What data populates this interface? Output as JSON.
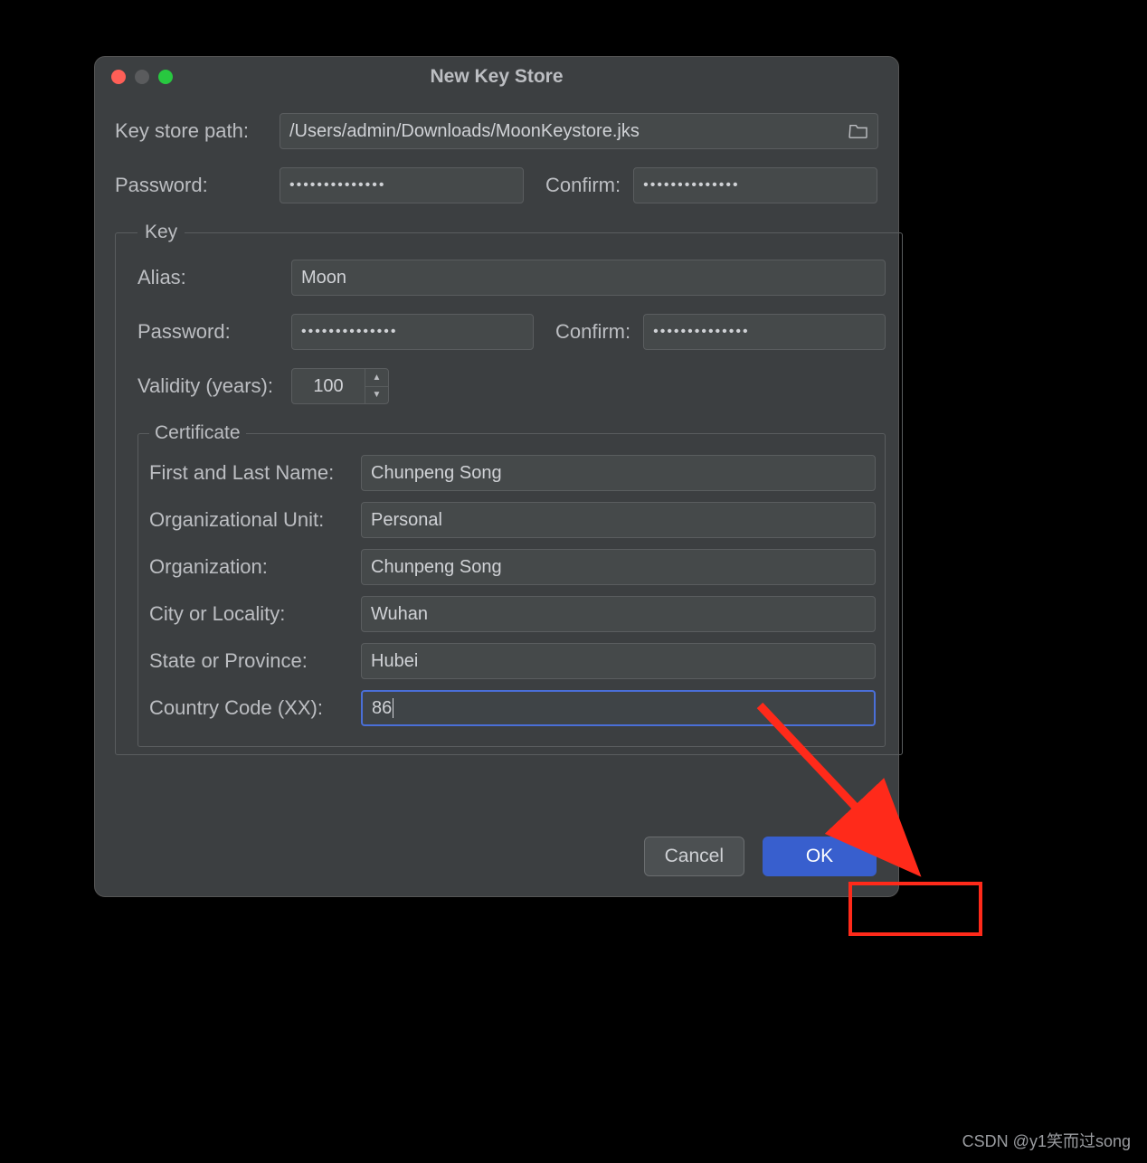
{
  "dialog": {
    "title": "New Key Store",
    "keystore_path_label": "Key store path:",
    "keystore_path_value": "/Users/admin/Downloads/MoonKeystore.jks",
    "password_label": "Password:",
    "password_value": "••••••••••••••",
    "confirm_label": "Confirm:",
    "confirm_value": "••••••••••••••"
  },
  "key": {
    "legend": "Key",
    "alias_label": "Alias:",
    "alias_value": "Moon",
    "password_label": "Password:",
    "password_value": "••••••••••••••",
    "confirm_label": "Confirm:",
    "confirm_value": "••••••••••••••",
    "validity_label": "Validity (years):",
    "validity_value": "100"
  },
  "certificate": {
    "legend": "Certificate",
    "first_last_label": "First and Last Name:",
    "first_last_value": "Chunpeng Song",
    "org_unit_label": "Organizational Unit:",
    "org_unit_value": "Personal",
    "org_label": "Organization:",
    "org_value": "Chunpeng Song",
    "city_label": "City or Locality:",
    "city_value": "Wuhan",
    "state_label": "State or Province:",
    "state_value": "Hubei",
    "country_label": "Country Code (XX):",
    "country_value": "86"
  },
  "buttons": {
    "cancel": "Cancel",
    "ok": "OK"
  },
  "watermark": "CSDN @y1笑而过song",
  "annotation": {
    "arrow_color": "#ff2a1a"
  }
}
